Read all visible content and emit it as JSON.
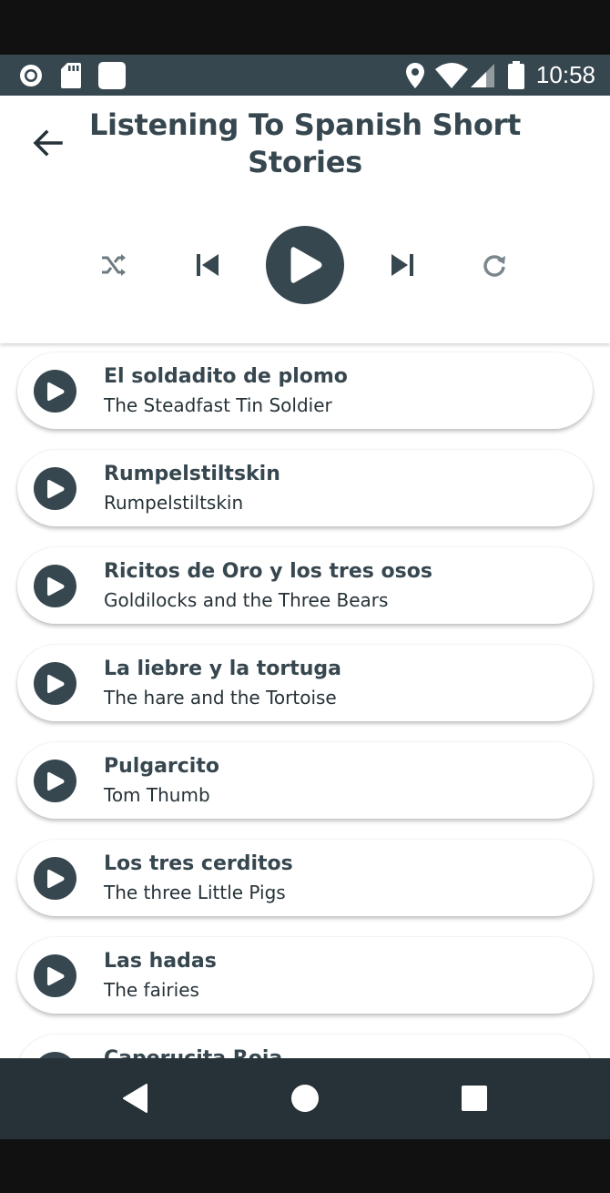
{
  "status_bar": {
    "time": "10:58",
    "left_icons": [
      "record-icon",
      "sd-card-icon",
      "square-notification-icon"
    ],
    "right_icons": [
      "location-icon",
      "wifi-icon",
      "signal-icon",
      "battery-icon"
    ]
  },
  "header": {
    "title": "Listening To Spanish Short Stories",
    "back_icon": "arrow-left-icon"
  },
  "player_controls": {
    "shuffle_icon": "shuffle-icon",
    "previous_icon": "skip-previous-icon",
    "play_icon": "play-icon",
    "next_icon": "skip-next-icon",
    "repeat_icon": "repeat-icon"
  },
  "stories": [
    {
      "title": "El soldadito de plomo",
      "subtitle": "The Steadfast Tin Soldier"
    },
    {
      "title": "Rumpelstiltskin",
      "subtitle": "Rumpelstiltskin"
    },
    {
      "title": "Ricitos de Oro y los tres osos",
      "subtitle": "Goldilocks and the Three Bears"
    },
    {
      "title": "La liebre y la tortuga",
      "subtitle": "The hare and the Tortoise"
    },
    {
      "title": "Pulgarcito",
      "subtitle": "Tom Thumb"
    },
    {
      "title": "Los tres cerditos",
      "subtitle": "The three Little Pigs"
    },
    {
      "title": "Las hadas",
      "subtitle": "The fairies"
    },
    {
      "title": "Caperucita Roja",
      "subtitle": ""
    }
  ],
  "nav_bar": {
    "back_icon": "nav-back-icon",
    "home_icon": "nav-home-icon",
    "recents_icon": "nav-recents-icon"
  },
  "colors": {
    "primary": "#37474f",
    "status_bar": "#37474f",
    "nav_bar": "#263238",
    "background": "#ffffff"
  }
}
